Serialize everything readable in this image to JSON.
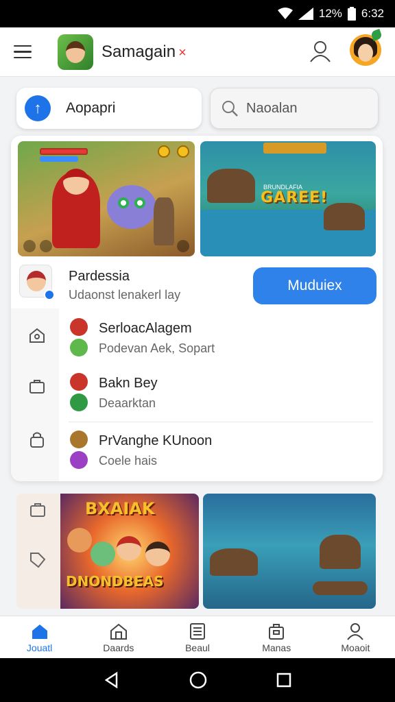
{
  "status_bar": {
    "battery": "12%",
    "time": "6:32"
  },
  "app_bar": {
    "title": "Samagain",
    "title_mark": "×"
  },
  "actions": {
    "primary_label": "Aopapri",
    "search_placeholder": "Naoalan"
  },
  "featured": {
    "banner_text": "GAREE!",
    "banner_subtext": "BRUNDLAFIA",
    "title": "Pardessia",
    "subtitle": "Udaonst lenakerl lay",
    "button_label": "Muduiex"
  },
  "list": [
    {
      "title": "SerloacAlagem",
      "subtitle": "Podevan Aek, Sopart"
    },
    {
      "title": "Bakn Bey",
      "subtitle": "Deaarktan"
    },
    {
      "title": "PrVanghe KUnoon",
      "subtitle": "Coele hais"
    }
  ],
  "promo": {
    "title_top": "BXAIAK",
    "title_bottom": "DNONDBEAS"
  },
  "bottom_nav": [
    {
      "label": "Jouatl",
      "icon": "home-icon",
      "active": true
    },
    {
      "label": "Daards",
      "icon": "store-icon",
      "active": false
    },
    {
      "label": "Beaul",
      "icon": "document-icon",
      "active": false
    },
    {
      "label": "Manas",
      "icon": "briefcase-icon",
      "active": false
    },
    {
      "label": "Moaoit",
      "icon": "person-icon",
      "active": false
    }
  ],
  "colors": {
    "accent": "#1e73e8",
    "button": "#2f82ea",
    "mark": "#e53935"
  }
}
